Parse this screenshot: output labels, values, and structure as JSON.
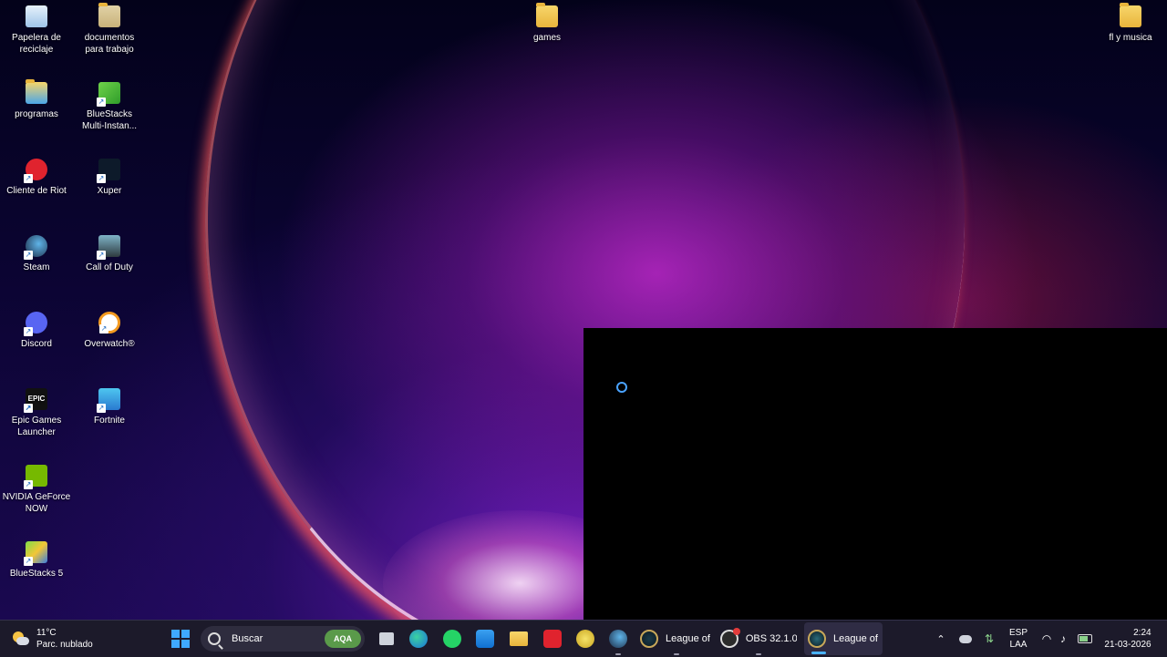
{
  "desktop": {
    "icons": [
      {
        "label": "Papelera de reciclaje",
        "icon": "recycle-bin-icon"
      },
      {
        "label": "documentos para trabajo",
        "icon": "folder-icon"
      },
      {
        "label": "games",
        "icon": "folder-icon"
      },
      {
        "label": "fl y musica",
        "icon": "folder-icon"
      },
      {
        "label": "programas",
        "icon": "folder-icon"
      },
      {
        "label": "BlueStacks Multi-Instan...",
        "icon": "bluestacks-multi-instance-icon"
      },
      {
        "label": "Cliente de Riot",
        "icon": "riot-client-icon"
      },
      {
        "label": "Xuper",
        "icon": "xuper-icon"
      },
      {
        "label": "Steam",
        "icon": "steam-icon"
      },
      {
        "label": "Call of Duty",
        "icon": "call-of-duty-icon"
      },
      {
        "label": "Discord",
        "icon": "discord-icon"
      },
      {
        "label": "Overwatch®",
        "icon": "overwatch-icon"
      },
      {
        "label": "Epic Games Launcher",
        "icon": "epic-games-icon"
      },
      {
        "label": "Fortnite",
        "icon": "fortnite-icon"
      },
      {
        "label": "NVIDIA GeForce NOW",
        "icon": "nvidia-geforce-now-icon"
      },
      {
        "label": "BlueStacks 5",
        "icon": "bluestacks-icon"
      }
    ],
    "epic_icon_text": "EPIC"
  },
  "taskbar": {
    "weather": {
      "temp": "11°C",
      "condition": "Parc. nublado"
    },
    "search": {
      "placeholder": "Buscar",
      "badge": "AQA"
    },
    "pinned": [
      {
        "name": "task-view",
        "icon": "task-view-icon"
      },
      {
        "name": "edge",
        "icon": "edge-icon"
      },
      {
        "name": "whatsapp",
        "icon": "whatsapp-icon"
      },
      {
        "name": "microsoft-store",
        "icon": "store-icon"
      },
      {
        "name": "file-explorer",
        "icon": "folder-icon"
      },
      {
        "name": "riot-client",
        "icon": "riot-client-icon"
      },
      {
        "name": "lol-tool",
        "icon": "lol-helper-icon"
      },
      {
        "name": "steam",
        "icon": "steam-icon"
      }
    ],
    "tasks": [
      {
        "label": "League of",
        "icon": "league-of-legends-icon"
      },
      {
        "label": "OBS 32.1.0",
        "icon": "obs-icon"
      },
      {
        "label": "League of L",
        "icon": "league-of-legends-icon"
      }
    ],
    "tray": {
      "language": "ESP",
      "layout": "LAA",
      "time": "2:24",
      "date": "21-03-2026"
    }
  },
  "colors": {
    "taskbar_bg": "#1c1a2a",
    "accent": "#4ab3ff"
  }
}
